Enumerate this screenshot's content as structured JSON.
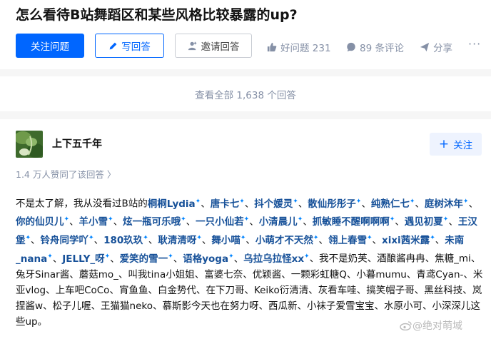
{
  "question": {
    "title": "怎么看待B站舞蹈区和某些风格比较暴露的up?",
    "follow_label": "关注问题",
    "write_label": "写回答",
    "invite_label": "邀请回答",
    "good_label": "好问题 231",
    "comments_label": "89 条评论",
    "share_label": "分享",
    "more_label": "···"
  },
  "view_all_label": "查看全部 1,638 个回答",
  "answer": {
    "author": "上下五千年",
    "follow_label": "关注",
    "votes_label": "1.4 万人赞同了该回答 〉",
    "intro": "不是太了解，我从没看过B站的",
    "links": [
      "桐桐Lydia",
      "唐卡七",
      "抖个媛灵",
      "散仙彤彤子",
      "纯熟仁七",
      "庭树沐年",
      "你的仙贝儿",
      "羊小雪",
      "炫一瓶可乐哦",
      "一只小仙若",
      "小清晨儿",
      "抓敏睡不醒啊啊啊",
      "遇见初夏",
      "王汉堡",
      "铃舟同学吖",
      "180玖玖",
      "耿清清呀",
      "舞小喵",
      "小萌才不天然",
      "翎上春雪",
      "xixi茜米露",
      "未南_nana",
      "JELLY_呀",
      "爱笑的雪一",
      "语格yoga",
      "乌拉乌拉怪xx"
    ],
    "rest": "、我不是奶芙、酒酿酱冉冉、焦糖_mi、兔牙Sinar酱、蘑菇mo_、叫我tina小姐姐、富婆七奈、优颖酱、一颗彩虹糖Q、小暮mumu、青鸢Cyan-、米亚vlog、上车吧CoCo、宵鱼鱼、白金势代、在下刀哥、Keiko衍清清、灰看车哇、搞笑帽子哥、黑丝科技、岚捏酱w、松子儿喔、王猫猫neko、慕斯影今天也在努力呀、西瓜新、小袜子爱雪宝宝、水原小可、小深深儿这些up。"
  },
  "watermark": "@绝对萌域",
  "colors": {
    "brand_blue": "#0066ff",
    "link_blue": "#175199",
    "muted": "#8590a6"
  }
}
